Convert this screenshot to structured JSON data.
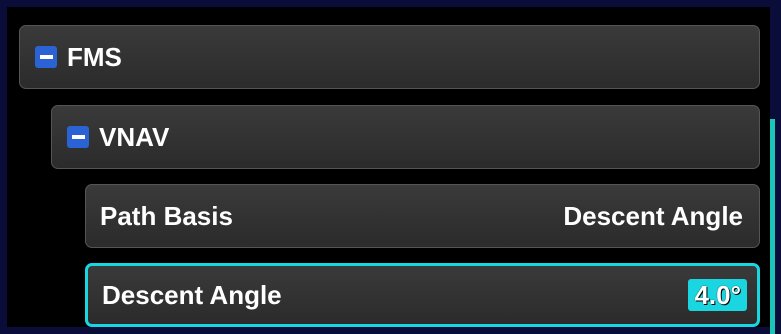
{
  "tree": {
    "fms": {
      "label": "FMS",
      "expanded": true
    },
    "vnav": {
      "label": "VNAV",
      "expanded": true
    },
    "path_basis": {
      "label": "Path Basis",
      "value": "Descent Angle"
    },
    "descent_angle": {
      "label": "Descent Angle",
      "value": "4.0°",
      "selected": true
    }
  },
  "colors": {
    "accent": "#19d6e0",
    "toggle": "#2c63d4",
    "background": "#000000",
    "frame": "#0a0d3a"
  },
  "icons": {
    "collapse": "minus-square-icon"
  }
}
